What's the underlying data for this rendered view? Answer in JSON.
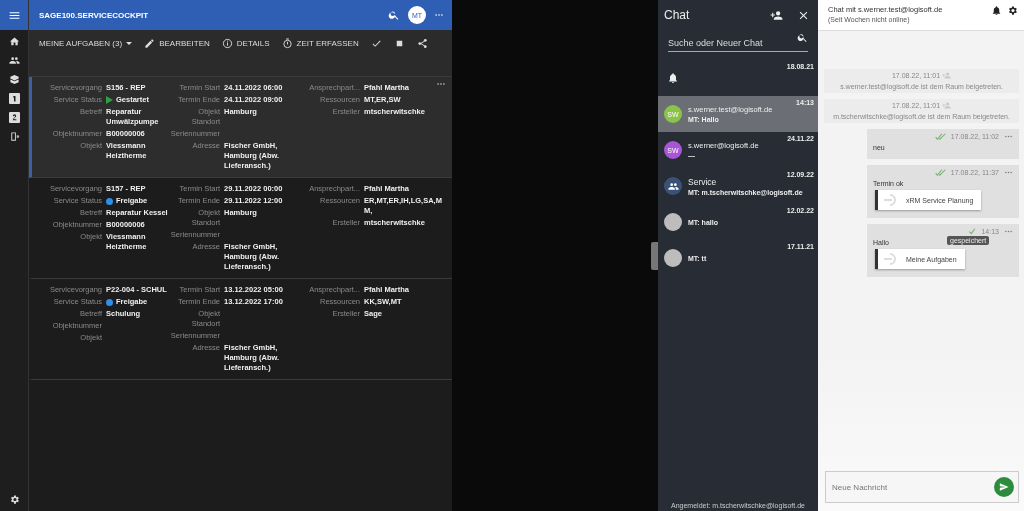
{
  "app_bar": {
    "title": "SAGE100.SERVICECOCKPIT",
    "avatar": "MT"
  },
  "toolbar": {
    "view": "MEINE AUFGABEN (3)",
    "actions": [
      {
        "kind": "edit",
        "label": "BEARBEITEN"
      },
      {
        "kind": "info",
        "label": "DETAILS"
      },
      {
        "kind": "timer",
        "label": "ZEIT ERFASSEN"
      }
    ]
  },
  "tasks": [
    {
      "selected": true,
      "columns": [
        [
          {
            "label": "Servicevorgang",
            "value": "S156 - REP"
          },
          {
            "label": "Service Status",
            "value": "Gestartet",
            "kind": "play",
            "color": "#2ea043"
          },
          {
            "label": "Betreff",
            "value": "Reparatur Umwälzpumpe"
          },
          {
            "label": "Objektnummer",
            "value": "B00000006"
          },
          {
            "label": "Objekt",
            "value": "Viessmann Heiztherme"
          }
        ],
        [
          {
            "label": "Termin Start",
            "value": "24.11.2022 06:00"
          },
          {
            "label": "Termin Ende",
            "value": "24.11.2022 09:00"
          },
          {
            "label": "Objekt Standort",
            "value": "Hamburg"
          },
          {
            "label": "Seriennummer"
          },
          {
            "label": "Adresse",
            "value": "Fischer GmbH, Hamburg (Abw. Lieferansch.)"
          }
        ],
        [
          {
            "label": "Ansprechpart...",
            "value": "Pfahl Martha"
          },
          {
            "label": "Ressourcen",
            "value": "MT,ER,SW"
          },
          {
            "label": "Ersteller",
            "value": "mtscherwitschke"
          }
        ]
      ]
    },
    {
      "selected": false,
      "columns": [
        [
          {
            "label": "Servicevorgang",
            "value": "S157 - REP"
          },
          {
            "label": "Service Status",
            "value": "Freigabe",
            "kind": "dot",
            "color": "#2f8fe8"
          },
          {
            "label": "Betreff",
            "value": "Reparatur Kessel"
          },
          {
            "label": "Objektnummer",
            "value": "B00000006"
          },
          {
            "label": "Objekt",
            "value": "Viessmann Heiztherme"
          }
        ],
        [
          {
            "label": "Termin Start",
            "value": "29.11.2022 00:00"
          },
          {
            "label": "Termin Ende",
            "value": "29.11.2022 12:00"
          },
          {
            "label": "Objekt Standort",
            "value": "Hamburg"
          },
          {
            "label": "Seriennummer"
          },
          {
            "label": "Adresse",
            "value": "Fischer GmbH, Hamburg (Abw. Lieferansch.)"
          }
        ],
        [
          {
            "label": "Ansprechpart...",
            "value": "Pfahl Martha"
          },
          {
            "label": "Ressourcen",
            "value": "ER,MT,ER,IH,LG,SA,MM,"
          },
          {
            "label": "Ersteller",
            "value": "mtscherwitschke"
          }
        ]
      ]
    },
    {
      "selected": false,
      "columns": [
        [
          {
            "label": "Servicevorgang",
            "value": "P22-004 - SCHUL"
          },
          {
            "label": "Service Status",
            "value": "Freigabe",
            "kind": "dot",
            "color": "#2f8fe8"
          },
          {
            "label": "Betreff",
            "value": "Schulung"
          },
          {
            "label": "Objektnummer"
          },
          {
            "label": "Objekt"
          }
        ],
        [
          {
            "label": "Termin Start",
            "value": "13.12.2022 05:00"
          },
          {
            "label": "Termin Ende",
            "value": "13.12.2022 17:00"
          },
          {
            "label": "Objekt Standort"
          },
          {
            "label": "Seriennummer"
          },
          {
            "label": "Adresse",
            "value": "Fischer GmbH, Hamburg (Abw. Lieferansch.)"
          }
        ],
        [
          {
            "label": "Ansprechpart...",
            "value": "Pfahl Martha"
          },
          {
            "label": "Ressourcen",
            "value": "KK,SW,MT"
          },
          {
            "label": "Ersteller",
            "value": "Sage"
          }
        ]
      ]
    }
  ],
  "chat": {
    "title": "Chat",
    "search": {
      "placeholder": "Suche oder Neuer Chat"
    },
    "items": [
      {
        "kind": "notification",
        "date": "18.08.21",
        "selected": false
      },
      {
        "kind": "contact",
        "avatar": "SW",
        "color": "#8bc34a",
        "name": "s.werner.test@logisoft.de",
        "preview": "MT: Hallo",
        "date": "14:13",
        "selected": true
      },
      {
        "kind": "contact",
        "avatar": "SW",
        "color": "#a855d8",
        "name": "s.werner@logisoft.de",
        "preview": "—",
        "date": "24.11.22",
        "selected": false
      },
      {
        "kind": "group",
        "color": "#3b5278",
        "name": "Service",
        "preview": "MT: m.tscherwitschke@logisoft.de",
        "date": "12.09.22",
        "selected": false
      },
      {
        "kind": "blank",
        "color": "#bdbdbd",
        "preview": "MT: hallo",
        "date": "12.02.22",
        "selected": false
      },
      {
        "kind": "blank",
        "color": "#bdbdbd",
        "preview": "MT: tt",
        "date": "17.11.21",
        "selected": false
      }
    ],
    "footer": "Angemeldet: m.tscherwitschke@logisoft.de"
  },
  "conversation": {
    "title": "Chat mit s.werner.test@logisoft.de",
    "subtitle": "(Seit Wochen nicht online)",
    "messages": [
      {
        "kind": "system",
        "time": "17.08.22, 11:01",
        "text": "s.werner.test@logisoft.de ist dem Raum beigetreten."
      },
      {
        "kind": "system",
        "time": "17.08.22, 11:01",
        "text": "m.tscherwitschke@logisoft.de ist dem Raum beigetreten."
      },
      {
        "kind": "own",
        "read": true,
        "time": "17.08.22, 11:02",
        "text": "neu"
      },
      {
        "kind": "own",
        "read": true,
        "time": "17.08.22, 11:37",
        "text": "Termin ok",
        "link": "xRM Service Planung"
      },
      {
        "kind": "own",
        "read": false,
        "time": "14:13",
        "text": "Hallo",
        "link": "Meine Aufgaben",
        "tooltip": "gespeichert"
      }
    ],
    "input": {
      "placeholder": "Neue Nachricht"
    }
  }
}
